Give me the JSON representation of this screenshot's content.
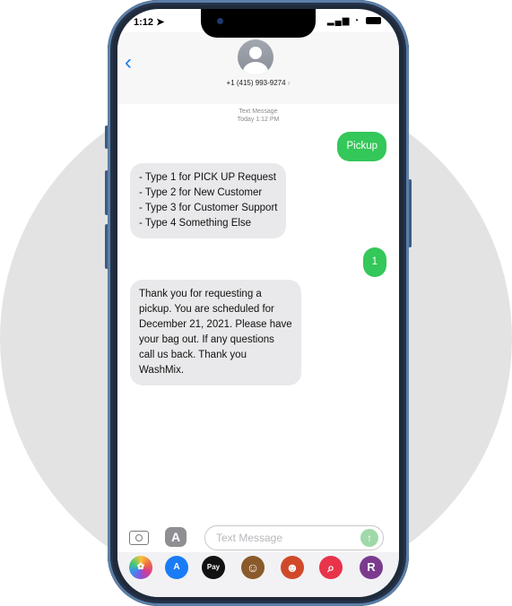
{
  "status": {
    "time": "1:12",
    "signal": "▂▄▆",
    "wifi": "◔"
  },
  "header": {
    "back_glyph": "‹",
    "contact_number": "+1 (415) 993-9274",
    "chevron": "›"
  },
  "thread": {
    "meta_line1": "Text Message",
    "meta_line2": "Today 1:12 PM",
    "messages": [
      {
        "direction": "out",
        "text": "Pickup"
      },
      {
        "direction": "in",
        "lines": [
          "- Type 1 for PICK UP Request",
          "- Type 2 for New Customer",
          "- Type 3 for Customer Support",
          "- Type 4 Something Else"
        ]
      },
      {
        "direction": "out",
        "text": "1"
      },
      {
        "direction": "in",
        "lines": [
          "Thank you for requesting a",
          "pickup. You are scheduled for",
          "December 21, 2021. Please have",
          "your bag out. If any questions",
          "call us back. Thank you",
          "WashMix."
        ]
      }
    ]
  },
  "compose": {
    "placeholder": "Text Message",
    "apps_glyph": "A",
    "send_glyph": "↑"
  },
  "dock": {
    "apps": [
      {
        "name": "photos-app-icon",
        "glyph": "✿",
        "color": "#ffffff"
      },
      {
        "name": "app-store-app-icon",
        "glyph": "A",
        "color": "#1a7cf5"
      },
      {
        "name": "apple-pay-app-icon",
        "glyph": "Pay",
        "color": "#111111"
      },
      {
        "name": "memoji-app-icon",
        "glyph": "☺",
        "color": "#8a5a2b"
      },
      {
        "name": "animoji-app-icon",
        "glyph": "☻",
        "color": "#d04a2a"
      },
      {
        "name": "search-images-app-icon",
        "glyph": "⌕",
        "color": "#e8334a"
      },
      {
        "name": "r-app-icon",
        "glyph": "R",
        "color": "#7b3a8e"
      }
    ]
  },
  "colors": {
    "outgoing": "#34c759",
    "incoming": "#e9e9eb",
    "accent": "#1a7cf5"
  }
}
